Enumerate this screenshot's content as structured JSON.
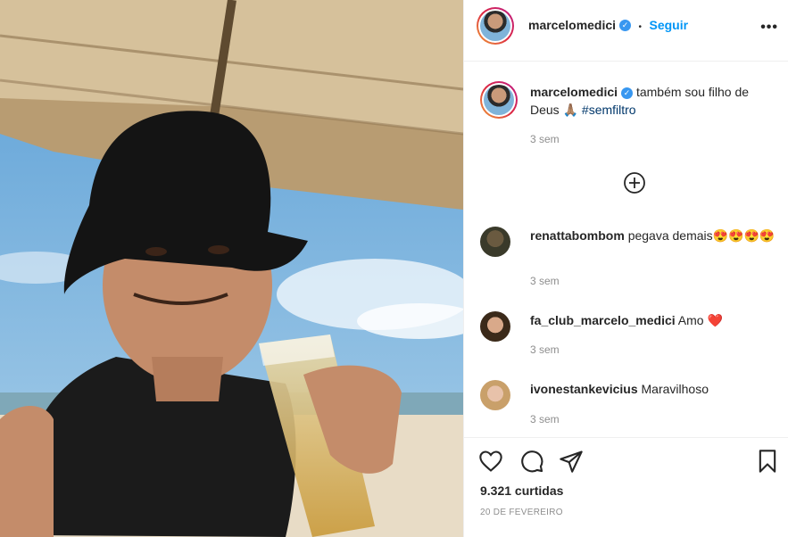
{
  "post": {
    "author": "marcelomedici",
    "follow_label": "Seguir",
    "separator": "•",
    "more_icon": "•••",
    "verified_icon": "✓"
  },
  "caption": {
    "username": "marcelomedici",
    "text": "também sou filho de Deus 🙏🏽",
    "hashtag": "#semfiltro",
    "time": "3 sem"
  },
  "comments": [
    {
      "username": "renattabombom",
      "text": "pegava demais😍😍😍😍",
      "time": "3 sem"
    },
    {
      "username": "fa_club_marcelo_medici",
      "text": "Amo ❤️",
      "time": "3 sem"
    },
    {
      "username": "ivonestankevicius",
      "text": "Maravilhoso",
      "time": "3 sem"
    }
  ],
  "footer": {
    "likes": "9.321 curtidas",
    "date": "20 DE FEVEREIRO"
  }
}
